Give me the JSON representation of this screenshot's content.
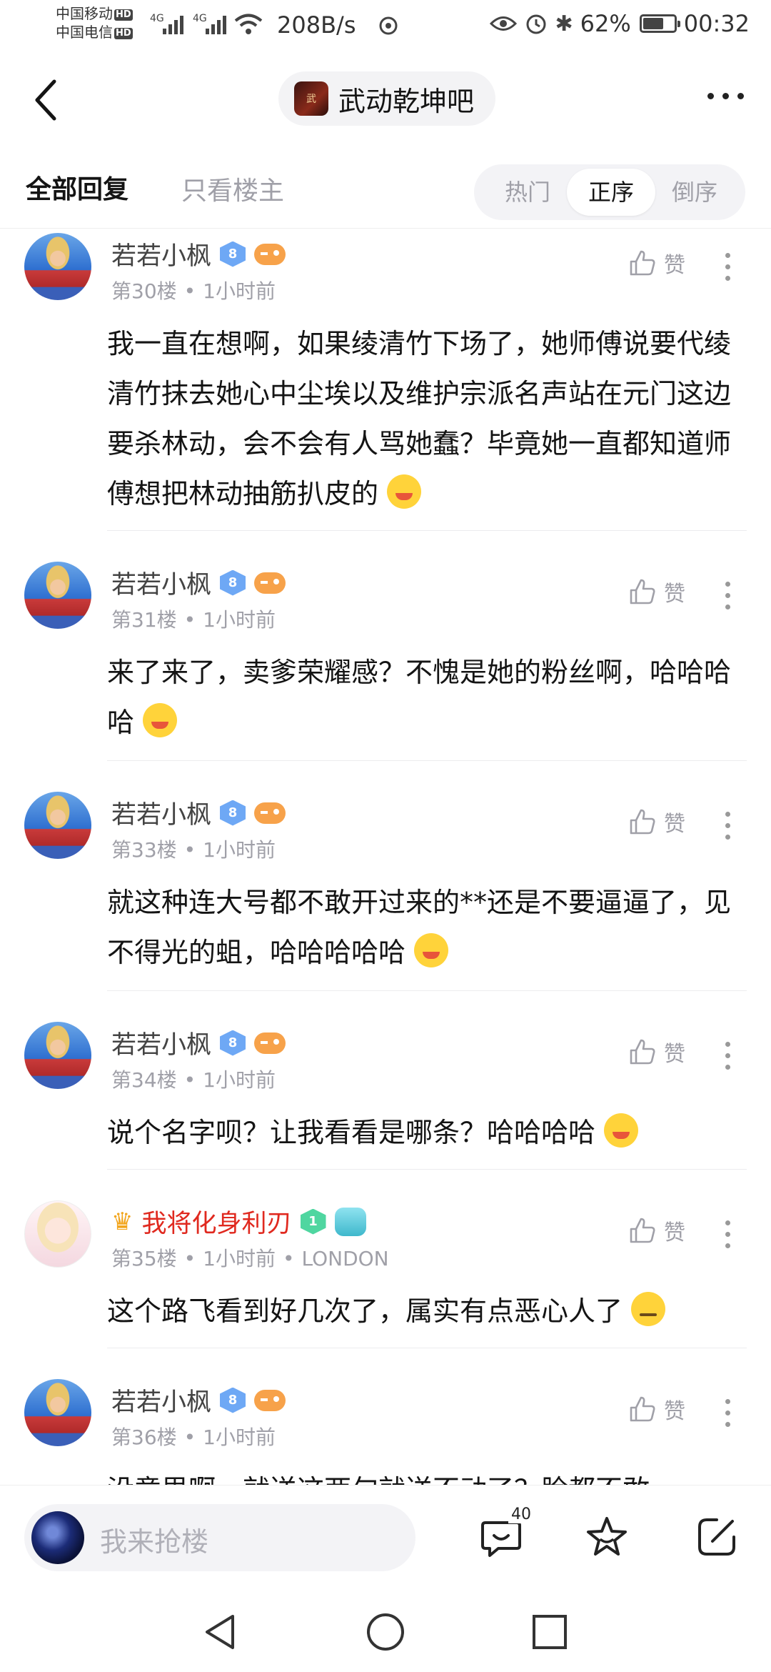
{
  "status_bar": {
    "carrier1": "中国移动",
    "carrier2": "中国电信",
    "hd": "HD",
    "net1": "4G",
    "net2": "4G",
    "net_speed": "208B/s",
    "battery": "62%",
    "battery_level": 0.62,
    "time": "00:32"
  },
  "header": {
    "forum_name": "武动乾坤吧"
  },
  "tabs": {
    "all_replies": "全部回复",
    "owner_only": "只看楼主",
    "sort_hot": "热门",
    "sort_asc": "正序",
    "sort_desc": "倒序"
  },
  "posts": [
    {
      "user": "若若小枫",
      "level": "8",
      "floor": "第30楼",
      "time": "1小时前",
      "like_label": "赞",
      "text": "我一直在想啊，如果绫清竹下场了，她师傅说要代绫清竹抹去她心中尘埃以及维护宗派名声站在元门这边要杀林动，会不会有人骂她蠢？毕竟她一直都知道师傅想把林动抽筋扒皮的"
    },
    {
      "user": "若若小枫",
      "level": "8",
      "floor": "第31楼",
      "time": "1小时前",
      "like_label": "赞",
      "text": "来了来了，卖爹荣耀感？不愧是她的粉丝啊，哈哈哈哈"
    },
    {
      "user": "若若小枫",
      "level": "8",
      "floor": "第33楼",
      "time": "1小时前",
      "like_label": "赞",
      "text": "就这种连大号都不敢开过来的**还是不要逼逼了，见不得光的蛆，哈哈哈哈哈"
    },
    {
      "user": "若若小枫",
      "level": "8",
      "floor": "第34楼",
      "time": "1小时前",
      "like_label": "赞",
      "text": "说个名字呗？让我看看是哪条？哈哈哈哈"
    },
    {
      "user": "我将化身利刃",
      "level": "1",
      "floor": "第35楼",
      "time": "1小时前",
      "location": "LONDON",
      "like_label": "赞",
      "text": "这个路飞看到好几次了，属实有点恶心人了"
    },
    {
      "user": "若若小枫",
      "level": "8",
      "floor": "第36楼",
      "time": "1小时前",
      "like_label": "赞",
      "text": "没意思啊，就送这两句就送不动了？脸都不敢"
    }
  ],
  "bottom_bar": {
    "input_placeholder": "我来抢楼",
    "comment_count": "40"
  },
  "colors": {
    "vip_name": "#e0291f",
    "level_badge": "#6ea8f5",
    "muted_text": "#a0a0a8"
  }
}
